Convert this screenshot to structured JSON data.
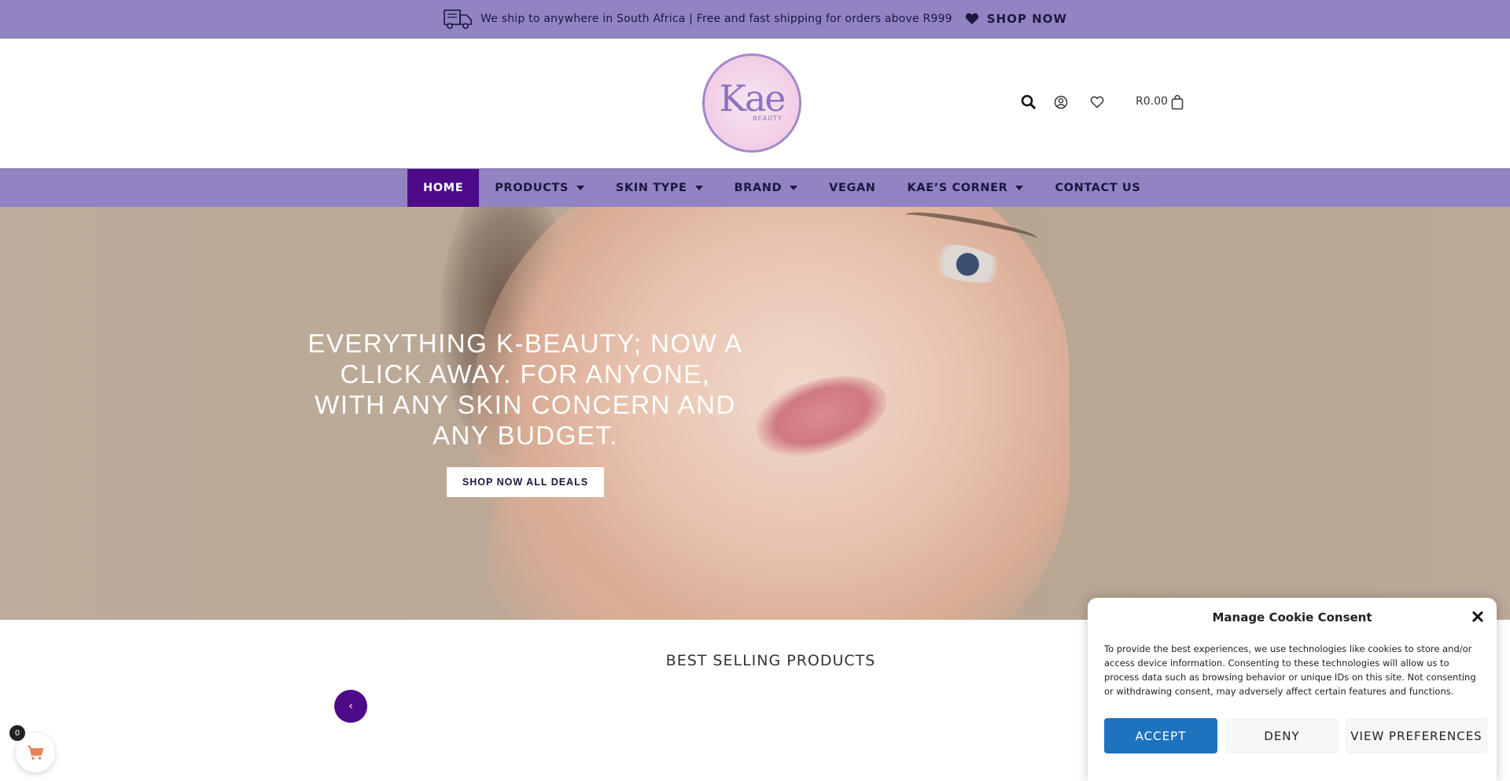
{
  "topbar": {
    "message": "We ship to anywhere in South Africa | Free and fast shipping for orders above R999",
    "shop_label": "SHOP NOW",
    "truck_icon": "truck-icon",
    "heart_icon": "heart-icon"
  },
  "header": {
    "logo_text": "Kae",
    "logo_sub": "BEAUTY",
    "cart_total": "R0.00",
    "icons": [
      "search-icon",
      "user-icon",
      "heart-icon",
      "bag-icon"
    ]
  },
  "nav": {
    "items": [
      {
        "label": "HOME",
        "active": true,
        "dropdown": false
      },
      {
        "label": "PRODUCTS",
        "active": false,
        "dropdown": true
      },
      {
        "label": "SKIN TYPE",
        "active": false,
        "dropdown": true
      },
      {
        "label": "BRAND",
        "active": false,
        "dropdown": true
      },
      {
        "label": "VEGAN",
        "active": false,
        "dropdown": false
      },
      {
        "label": "KAE’S CORNER",
        "active": false,
        "dropdown": true
      },
      {
        "label": "CONTACT US",
        "active": false,
        "dropdown": false
      }
    ]
  },
  "hero": {
    "title": "EVERYTHING K-BEAUTY; NOW A CLICK AWAY. FOR ANYONE, WITH ANY SKIN CONCERN AND ANY BUDGET.",
    "button_label": "SHOP NOW ALL DEALS"
  },
  "section": {
    "title": "BEST SELLING PRODUCTS",
    "prev_label": "‹"
  },
  "floating_cart": {
    "count": "0"
  },
  "cookie": {
    "title": "Manage Cookie Consent",
    "text": "To provide the best experiences, we use technologies like cookies to store and/or access device information. Consenting to these technologies will allow us to process data such as browsing behavior or unique IDs on this site. Not consenting or withdrawing consent, may adversely affect certain features and functions.",
    "accept_label": "ACCEPT",
    "deny_label": "DENY",
    "prefs_label": "VIEW PREFERENCES"
  },
  "colors": {
    "brand_purple": "#9284c2",
    "active_purple": "#4d0b8a",
    "accept_blue": "#1e73be"
  }
}
